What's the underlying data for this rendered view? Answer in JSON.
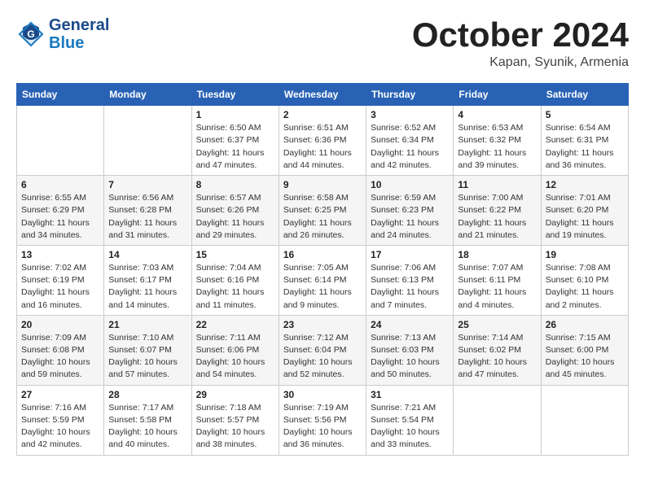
{
  "header": {
    "logo_line1": "General",
    "logo_line2": "Blue",
    "month": "October 2024",
    "location": "Kapan, Syunik, Armenia"
  },
  "weekdays": [
    "Sunday",
    "Monday",
    "Tuesday",
    "Wednesday",
    "Thursday",
    "Friday",
    "Saturday"
  ],
  "weeks": [
    [
      {
        "day": "",
        "detail": ""
      },
      {
        "day": "",
        "detail": ""
      },
      {
        "day": "1",
        "detail": "Sunrise: 6:50 AM\nSunset: 6:37 PM\nDaylight: 11 hours and 47 minutes."
      },
      {
        "day": "2",
        "detail": "Sunrise: 6:51 AM\nSunset: 6:36 PM\nDaylight: 11 hours and 44 minutes."
      },
      {
        "day": "3",
        "detail": "Sunrise: 6:52 AM\nSunset: 6:34 PM\nDaylight: 11 hours and 42 minutes."
      },
      {
        "day": "4",
        "detail": "Sunrise: 6:53 AM\nSunset: 6:32 PM\nDaylight: 11 hours and 39 minutes."
      },
      {
        "day": "5",
        "detail": "Sunrise: 6:54 AM\nSunset: 6:31 PM\nDaylight: 11 hours and 36 minutes."
      }
    ],
    [
      {
        "day": "6",
        "detail": "Sunrise: 6:55 AM\nSunset: 6:29 PM\nDaylight: 11 hours and 34 minutes."
      },
      {
        "day": "7",
        "detail": "Sunrise: 6:56 AM\nSunset: 6:28 PM\nDaylight: 11 hours and 31 minutes."
      },
      {
        "day": "8",
        "detail": "Sunrise: 6:57 AM\nSunset: 6:26 PM\nDaylight: 11 hours and 29 minutes."
      },
      {
        "day": "9",
        "detail": "Sunrise: 6:58 AM\nSunset: 6:25 PM\nDaylight: 11 hours and 26 minutes."
      },
      {
        "day": "10",
        "detail": "Sunrise: 6:59 AM\nSunset: 6:23 PM\nDaylight: 11 hours and 24 minutes."
      },
      {
        "day": "11",
        "detail": "Sunrise: 7:00 AM\nSunset: 6:22 PM\nDaylight: 11 hours and 21 minutes."
      },
      {
        "day": "12",
        "detail": "Sunrise: 7:01 AM\nSunset: 6:20 PM\nDaylight: 11 hours and 19 minutes."
      }
    ],
    [
      {
        "day": "13",
        "detail": "Sunrise: 7:02 AM\nSunset: 6:19 PM\nDaylight: 11 hours and 16 minutes."
      },
      {
        "day": "14",
        "detail": "Sunrise: 7:03 AM\nSunset: 6:17 PM\nDaylight: 11 hours and 14 minutes."
      },
      {
        "day": "15",
        "detail": "Sunrise: 7:04 AM\nSunset: 6:16 PM\nDaylight: 11 hours and 11 minutes."
      },
      {
        "day": "16",
        "detail": "Sunrise: 7:05 AM\nSunset: 6:14 PM\nDaylight: 11 hours and 9 minutes."
      },
      {
        "day": "17",
        "detail": "Sunrise: 7:06 AM\nSunset: 6:13 PM\nDaylight: 11 hours and 7 minutes."
      },
      {
        "day": "18",
        "detail": "Sunrise: 7:07 AM\nSunset: 6:11 PM\nDaylight: 11 hours and 4 minutes."
      },
      {
        "day": "19",
        "detail": "Sunrise: 7:08 AM\nSunset: 6:10 PM\nDaylight: 11 hours and 2 minutes."
      }
    ],
    [
      {
        "day": "20",
        "detail": "Sunrise: 7:09 AM\nSunset: 6:08 PM\nDaylight: 10 hours and 59 minutes."
      },
      {
        "day": "21",
        "detail": "Sunrise: 7:10 AM\nSunset: 6:07 PM\nDaylight: 10 hours and 57 minutes."
      },
      {
        "day": "22",
        "detail": "Sunrise: 7:11 AM\nSunset: 6:06 PM\nDaylight: 10 hours and 54 minutes."
      },
      {
        "day": "23",
        "detail": "Sunrise: 7:12 AM\nSunset: 6:04 PM\nDaylight: 10 hours and 52 minutes."
      },
      {
        "day": "24",
        "detail": "Sunrise: 7:13 AM\nSunset: 6:03 PM\nDaylight: 10 hours and 50 minutes."
      },
      {
        "day": "25",
        "detail": "Sunrise: 7:14 AM\nSunset: 6:02 PM\nDaylight: 10 hours and 47 minutes."
      },
      {
        "day": "26",
        "detail": "Sunrise: 7:15 AM\nSunset: 6:00 PM\nDaylight: 10 hours and 45 minutes."
      }
    ],
    [
      {
        "day": "27",
        "detail": "Sunrise: 7:16 AM\nSunset: 5:59 PM\nDaylight: 10 hours and 42 minutes."
      },
      {
        "day": "28",
        "detail": "Sunrise: 7:17 AM\nSunset: 5:58 PM\nDaylight: 10 hours and 40 minutes."
      },
      {
        "day": "29",
        "detail": "Sunrise: 7:18 AM\nSunset: 5:57 PM\nDaylight: 10 hours and 38 minutes."
      },
      {
        "day": "30",
        "detail": "Sunrise: 7:19 AM\nSunset: 5:56 PM\nDaylight: 10 hours and 36 minutes."
      },
      {
        "day": "31",
        "detail": "Sunrise: 7:21 AM\nSunset: 5:54 PM\nDaylight: 10 hours and 33 minutes."
      },
      {
        "day": "",
        "detail": ""
      },
      {
        "day": "",
        "detail": ""
      }
    ]
  ]
}
